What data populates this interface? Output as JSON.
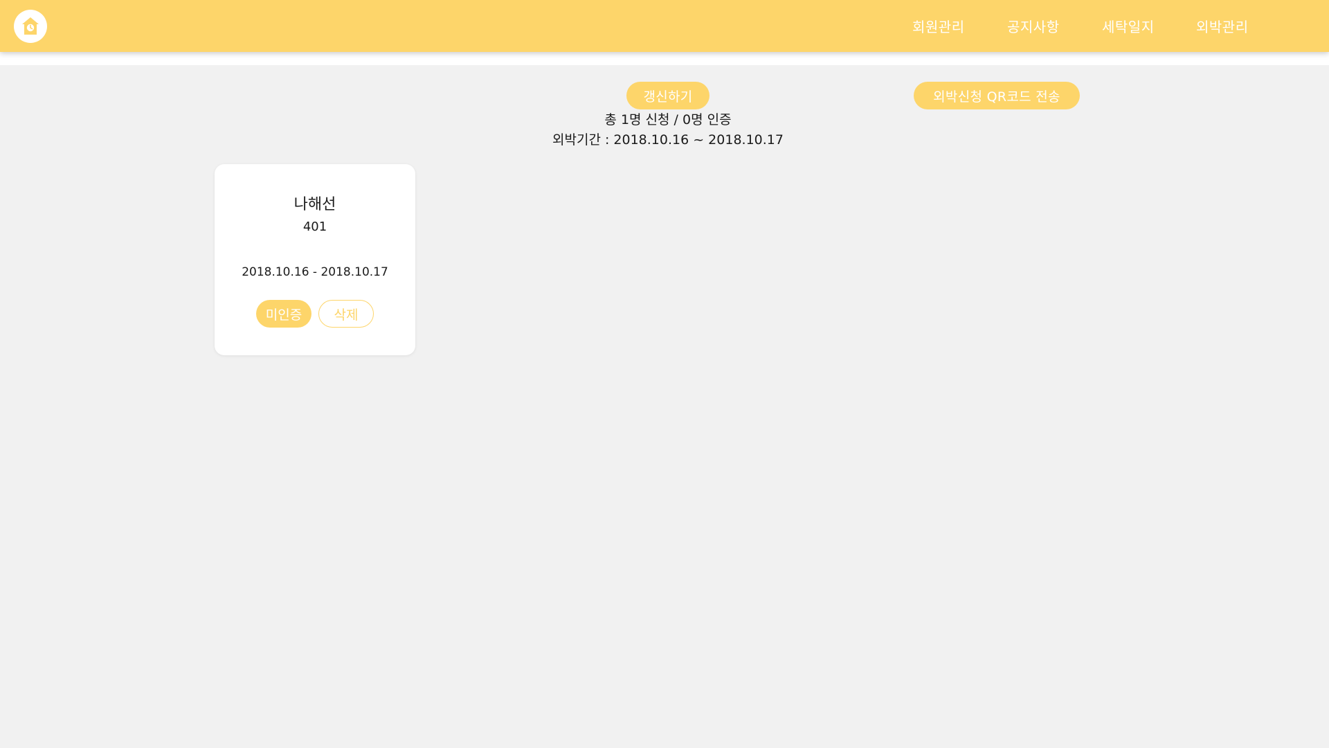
{
  "header": {
    "logo_icon": "home-clock-icon",
    "nav": [
      {
        "label": "회원관리"
      },
      {
        "label": "공지사항"
      },
      {
        "label": "세탁일지"
      },
      {
        "label": "외박관리"
      }
    ]
  },
  "toolbar": {
    "refresh_label": "갱신하기",
    "qr_label": "외박신청 QR코드 전송"
  },
  "summary": {
    "line1": "총 1명 신청 / 0명 인증",
    "line2": "외박기간 : 2018.10.16 ~ 2018.10.17"
  },
  "cards": [
    {
      "name": "나해선",
      "room": "401",
      "period": "2018.10.16 - 2018.10.17",
      "status_label": "미인증",
      "delete_label": "삭제"
    }
  ],
  "colors": {
    "accent": "#fdd56a",
    "background": "#f1f1f1",
    "card": "#ffffff"
  }
}
